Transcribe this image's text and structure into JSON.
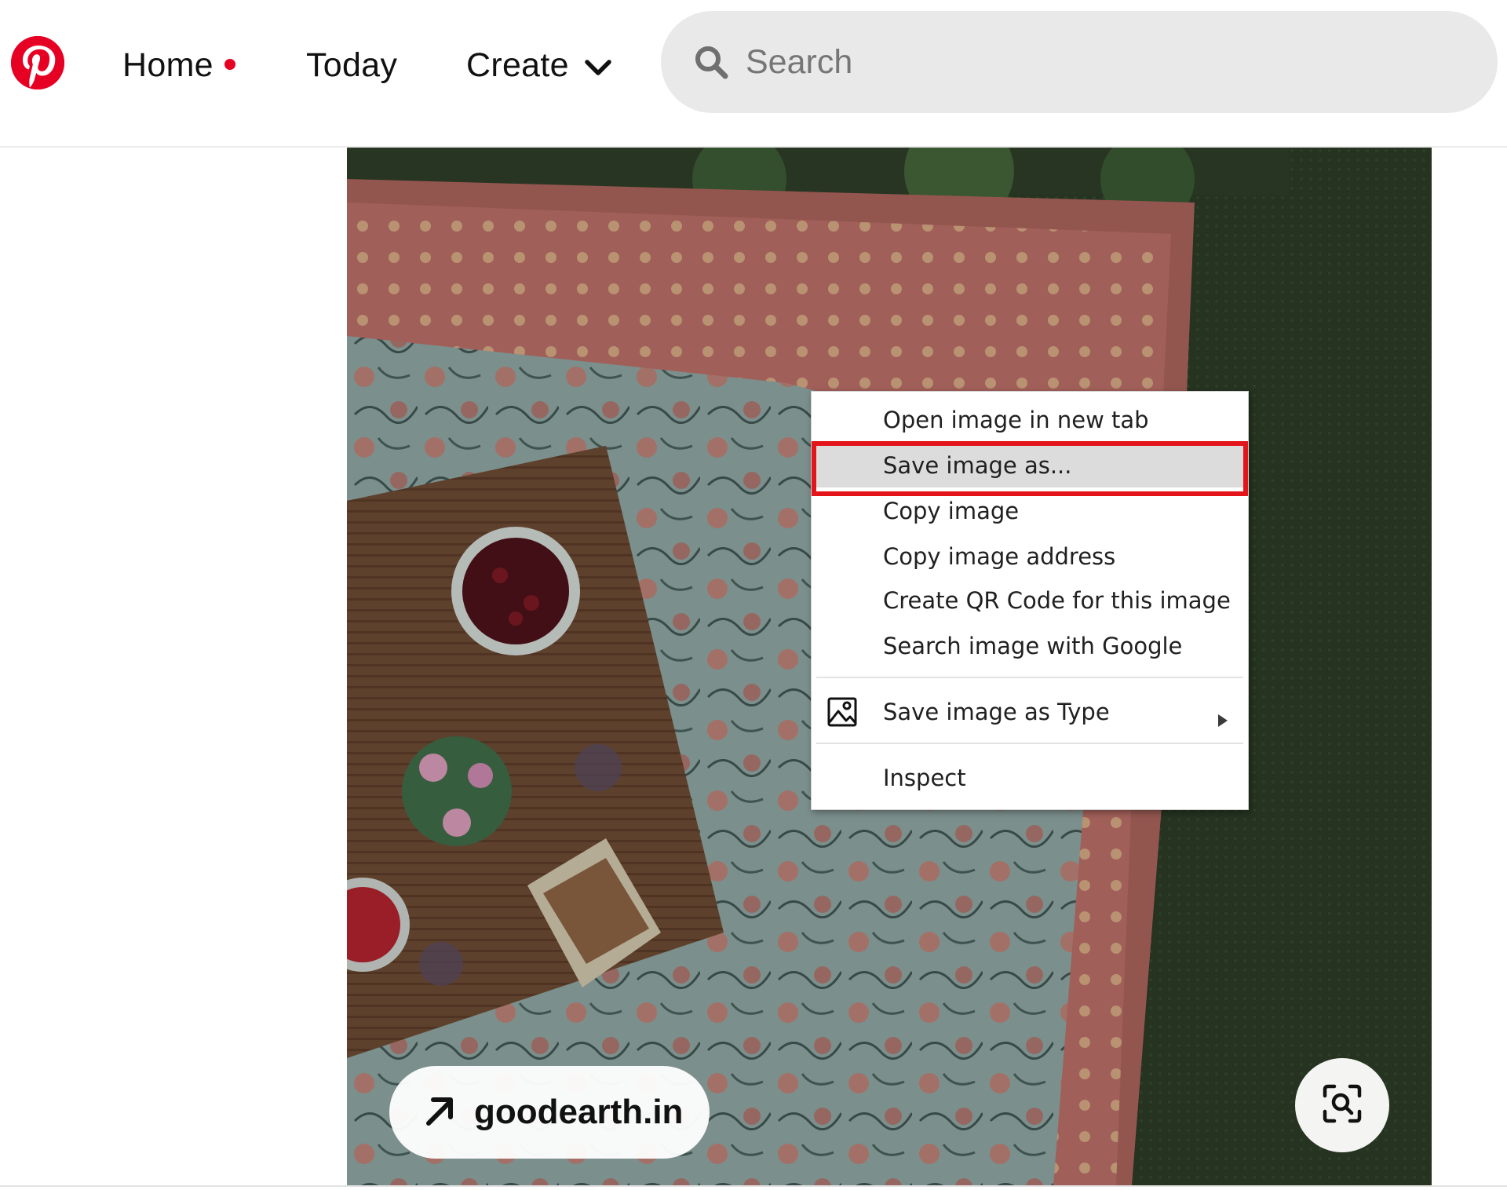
{
  "header": {
    "logo_icon": "pinterest-logo-icon",
    "nav": [
      {
        "label": "Home",
        "has_notification_dot": true
      },
      {
        "label": "Today"
      },
      {
        "label": "Create",
        "icon": "chevron-down-icon"
      }
    ],
    "search": {
      "placeholder": "Search",
      "value": ""
    }
  },
  "pin": {
    "image_description_icon": "picnic-photo",
    "source_link": {
      "label": "goodearth.in",
      "icon": "arrow-up-right-icon"
    },
    "visual_search_icon": "lens-search-icon"
  },
  "context_menu": {
    "items": [
      {
        "label": "Open image in new tab"
      },
      {
        "label": "Save image as...",
        "highlighted": true
      },
      {
        "label": "Copy image"
      },
      {
        "label": "Copy image address"
      },
      {
        "label": "Create QR Code for this image"
      },
      {
        "label": "Search image with Google"
      },
      {
        "label": "Save image as Type",
        "icon": "image-icon",
        "submenu": true
      },
      {
        "label": "Inspect"
      }
    ]
  },
  "colors": {
    "brand": "#e60023",
    "highlight_border": "#e4141b",
    "menu_hover": "#dcdcdc",
    "search_bg": "#e9e9e9"
  }
}
